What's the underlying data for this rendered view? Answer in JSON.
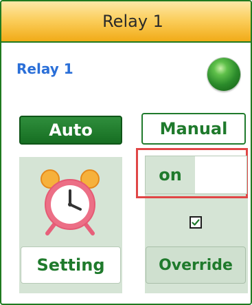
{
  "header": {
    "title": "Relay 1"
  },
  "relay": {
    "name": "Relay 1",
    "status_color": "#2b8b2b"
  },
  "mode": {
    "auto_label": "Auto",
    "manual_label": "Manual"
  },
  "auto_panel": {
    "icon": "alarm-clock-icon",
    "setting_label": "Setting"
  },
  "manual_panel": {
    "toggle_label": "on",
    "toggle_state": "on",
    "override_checked": true,
    "override_label": "Override"
  },
  "colors": {
    "accent_green": "#1f7a2c",
    "title_orange": "#f1ab17",
    "name_blue": "#2a6fd8",
    "highlight_red": "#e04646"
  }
}
